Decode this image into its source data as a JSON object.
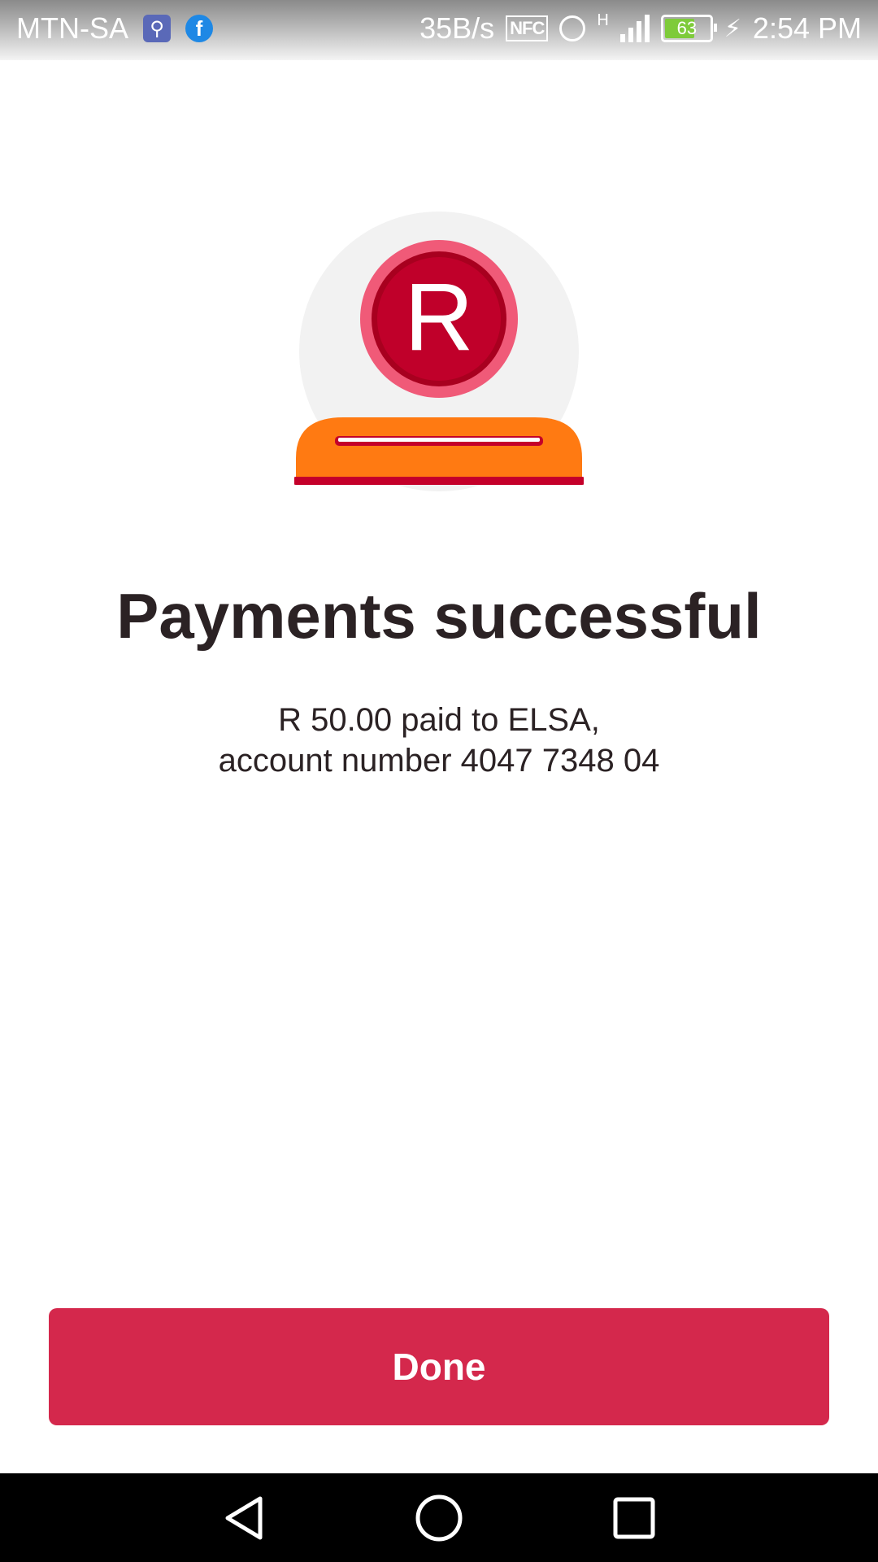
{
  "status_bar": {
    "carrier": "MTN-SA",
    "net_speed": "35B/s",
    "nfc": "NFC",
    "network_type": "H",
    "battery": "63",
    "time": "2:54 PM"
  },
  "icons": {
    "usb": "usb-icon",
    "facebook": "facebook-icon",
    "currency_symbol": "R"
  },
  "result": {
    "title": "Payments successful",
    "line1": "R 50.00 paid to ELSA,",
    "line2": "account number 4047 7348 04"
  },
  "actions": {
    "done_label": "Done"
  },
  "colors": {
    "accent": "#d4284c",
    "coin_inner": "#c0002a",
    "coin_ring": "#f05a78",
    "tray": "#ff7a12"
  }
}
